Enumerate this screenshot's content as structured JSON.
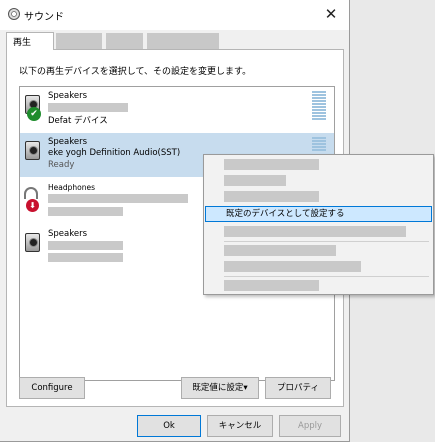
{
  "window": {
    "title": "サウンド",
    "close_glyph": "✕"
  },
  "tabs": [
    {
      "label": "再生"
    }
  ],
  "panel": {
    "instruction": "以下の再生デバイスを選択して、その設定を変更します。"
  },
  "devices": [
    {
      "name": "Speakers",
      "status": "Defat デバイス"
    },
    {
      "name": "Speakers",
      "description": "eke yogh Definition Audio(SST)",
      "status": "Ready"
    },
    {
      "name": "Headphones"
    },
    {
      "name": "Speakers"
    }
  ],
  "buttons": {
    "configure": "Configure",
    "set_default": "既定値に設定",
    "set_default_arrow": "▾",
    "properties": "プロパティ",
    "ok": "Ok",
    "cancel": "キャンセル",
    "apply": "Apply"
  },
  "context_menu": {
    "highlighted_item": "既定のデバイスとして設定する"
  },
  "icons": {
    "check": "✔",
    "down_arrow": "⬇"
  },
  "colors": {
    "selected_row": "#c7dcee",
    "menu_highlight": "#cde8ff",
    "accent": "#0078d7",
    "default_badge": "#1e8c2c",
    "disconnected_badge": "#c8102e"
  }
}
